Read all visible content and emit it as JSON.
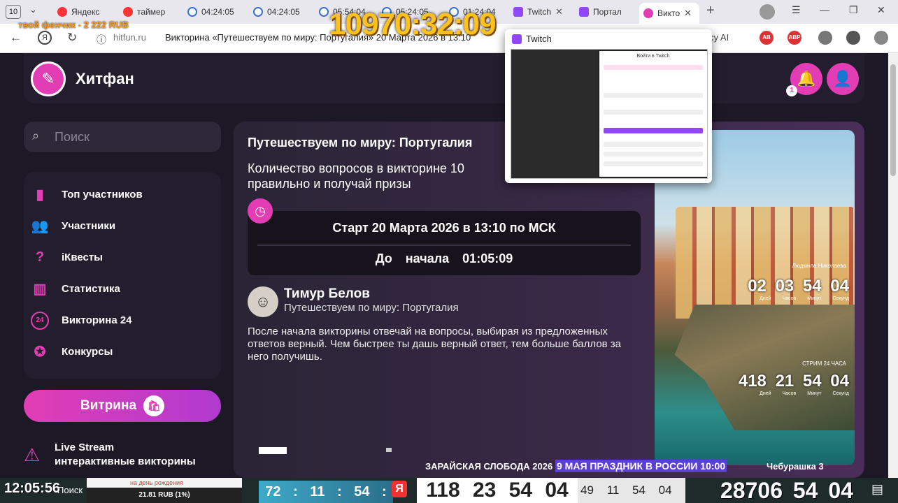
{
  "browser": {
    "tab_count": "10",
    "tabs": [
      {
        "label": "Яндекс",
        "icon": "yandex-icon"
      },
      {
        "label": "таймер",
        "icon": "yandex-icon"
      },
      {
        "label": "04:24:05",
        "icon": "timer-icon"
      },
      {
        "label": "04:24:05",
        "icon": "timer-icon"
      },
      {
        "label": "05:54:04",
        "icon": "timer-icon"
      },
      {
        "label": "05:24:05",
        "icon": "timer-icon"
      },
      {
        "label": "01:24:04",
        "icon": "timer-icon"
      },
      {
        "label": "Twitch",
        "icon": "twitch-icon"
      },
      {
        "label": "Портал",
        "icon": "twitch-icon"
      },
      {
        "label": "Викто",
        "icon": "hitfun-icon",
        "active": true
      }
    ],
    "url_host": "hitfun.ru",
    "url_title": "Викторина «Путешествуем по миру: Португалия» 20 Марта 2026 в 13:10",
    "url_suffix": "cy AI",
    "ext_badges": [
      "AB",
      "ABP"
    ]
  },
  "overlay": {
    "amount": "твой фенчик - 2 222 RUB",
    "big_timer": "10970:32:09"
  },
  "popup": {
    "title": "Twitch",
    "thumb_title": "Войти в Twitch"
  },
  "site": {
    "brand": "Хитфан",
    "notification_count": "1",
    "search_placeholder": "Поиск",
    "menu": [
      {
        "label": "Топ участников",
        "icon": "bar-chart-icon"
      },
      {
        "label": "Участники",
        "icon": "users-icon"
      },
      {
        "label": "iКвесты",
        "icon": "quest-icon"
      },
      {
        "label": "Статистика",
        "icon": "stats-icon"
      },
      {
        "label": "Викторина 24",
        "icon": "quiz24-icon"
      },
      {
        "label": "Конкурсы",
        "icon": "contest-icon"
      }
    ],
    "shop_label": "Витрина",
    "live_title": "Live Stream",
    "live_sub": "интерактивные викторины",
    "quiz": {
      "title": "Путешествуем по миру: Португалия",
      "desc": "Количество вопросов в викторине 10 правильно и получай призы",
      "start": "Старт 20 Марта 2026 в 13:10 по МСК",
      "countdown_label": "До начала",
      "countdown_value": "01:05:09",
      "author_name": "Тимур Белов",
      "author_sub": "Путешествуем по миру: Португалия",
      "rules": "После начала викторины отвечай на вопросы, выбирая из предложенных ответов верный. Чем быстрее ты дашь верный ответ, тем больше баллов за него получишь."
    },
    "photo": {
      "caption1": "Людмила Николаева",
      "nums1": "02 03 54 04",
      "units1": "Дней Часов Минут Секунд",
      "caption2": "СТРИМ 24 ЧАСА",
      "nums2": "418 21 54 04",
      "units2": "Дней Часов Минут Секунд"
    },
    "ticker": {
      "left": "ЗАРАЙСКАЯ СЛОБОДА 2026",
      "middle": "9 МАЯ ПРАЗДНИК В РОССИИ 10:00",
      "right": "Чебурашка 3"
    }
  },
  "taskbar": {
    "clock": "12:05:56",
    "search": "Поиск",
    "birthday": "на день рождения",
    "rub": "21.81 RUB (1%)",
    "timer1": "72 : 11 : 54 : 3",
    "timer2": "118 23 54 04",
    "timer3": "49 11 54 04",
    "timer4": "28706 54 04"
  }
}
